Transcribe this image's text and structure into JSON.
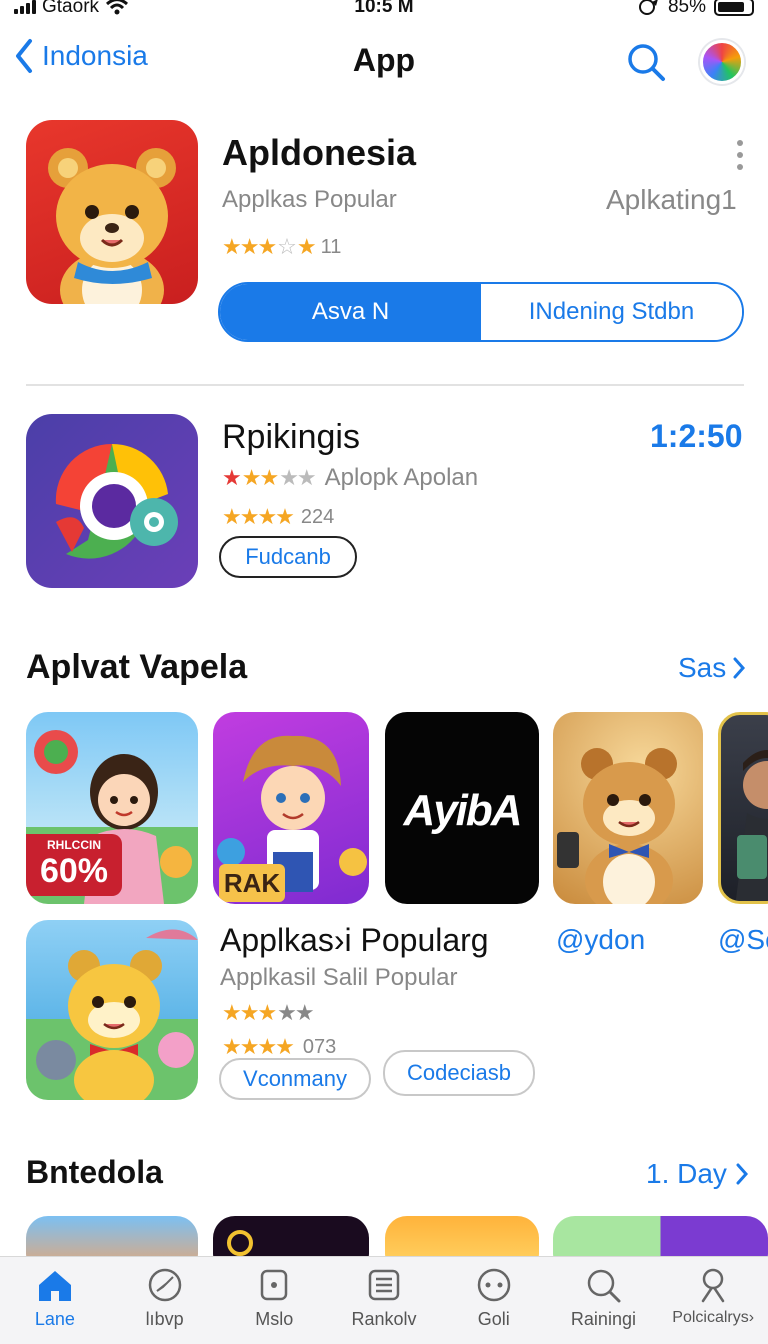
{
  "status": {
    "carrier": "Gtaork",
    "time": "10:5 M",
    "battery": "85%"
  },
  "nav": {
    "back_label": "Indonsia",
    "title": "App"
  },
  "featured": {
    "title": "Apldonesia",
    "subtitle": "Applkas Popular",
    "right_text": "Aplkating1",
    "rating_count": "11",
    "stars_filled": 3,
    "seg_left": "Asva N",
    "seg_right": "INdening Stdbn"
  },
  "second": {
    "title": "Rpikingis",
    "time": "1:2:50",
    "sub_line": "Aplopk Apolan",
    "rating_count": "224",
    "button": "Fudcanb"
  },
  "section1": {
    "title": "Aplvat Vapela",
    "link": "Sas",
    "tile1_badge_small": "RHLCCIN",
    "tile1_badge_big": "60%",
    "tile2_text": "RAK",
    "tile3_text": "AyibA"
  },
  "third": {
    "title": "Applkas›i Popularg",
    "subtitle": "Applkasil Salil Popular",
    "rating_count": "073",
    "btn1": "Vconmany",
    "btn2": "Codeciasb",
    "handle1": "@ydon",
    "handle2": "@Sc"
  },
  "section2": {
    "title": "Bntedola",
    "link": "1. Day"
  },
  "tabs": [
    {
      "label": "Lane",
      "icon": "home-icon"
    },
    {
      "label": "lıbvp",
      "icon": "compass-icon"
    },
    {
      "label": "Mslo",
      "icon": "square-icon"
    },
    {
      "label": "Rankolv",
      "icon": "list-icon"
    },
    {
      "label": "Goli",
      "icon": "face-icon"
    },
    {
      "label": "Rainingi",
      "icon": "search-icon"
    },
    {
      "label": "Polcicalrys›",
      "icon": "person-icon"
    }
  ],
  "colors": {
    "accent": "#1a7ae8",
    "star": "#f5a623"
  }
}
